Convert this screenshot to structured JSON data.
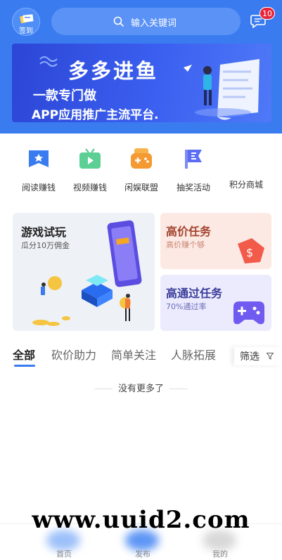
{
  "header": {
    "signin_label": "签到",
    "search_placeholder": "输入关键词",
    "message_count": "10",
    "bg_color": "#3a7cf0"
  },
  "banner": {
    "title": "多多进鱼",
    "line1": "一款专门做",
    "line2": "APP应用推广主流平台."
  },
  "nav": [
    {
      "label": "阅读赚钱",
      "icon": "book-star-icon",
      "color": "#3a7cf0"
    },
    {
      "label": "视频赚钱",
      "icon": "tv-play-icon",
      "color": "#4fc38b"
    },
    {
      "label": "闲娱联盟",
      "icon": "gamepad-icon",
      "color": "#f59a32"
    },
    {
      "label": "抽奖活动",
      "icon": "flag-icon",
      "color": "#5b6df2"
    },
    {
      "label": "积分商城",
      "icon": "shop-icon",
      "color": "#999999"
    }
  ],
  "cards": {
    "game_trial": {
      "title": "游戏试玩",
      "subtitle": "瓜分10万佣金"
    },
    "high_price": {
      "title": "高价任务",
      "subtitle": "高价赚个够"
    },
    "high_pass": {
      "title": "高通过任务",
      "subtitle": "70%通过率"
    }
  },
  "tabs": [
    {
      "label": "全部",
      "active": true
    },
    {
      "label": "砍价助力",
      "active": false
    },
    {
      "label": "简单关注",
      "active": false
    },
    {
      "label": "人脉拓展",
      "active": false
    }
  ],
  "filter_label": "筛选",
  "empty_text": "没有更多了",
  "bottom_nav": [
    "首页",
    "发布",
    "我的"
  ],
  "watermark": "www.uuid2.com"
}
